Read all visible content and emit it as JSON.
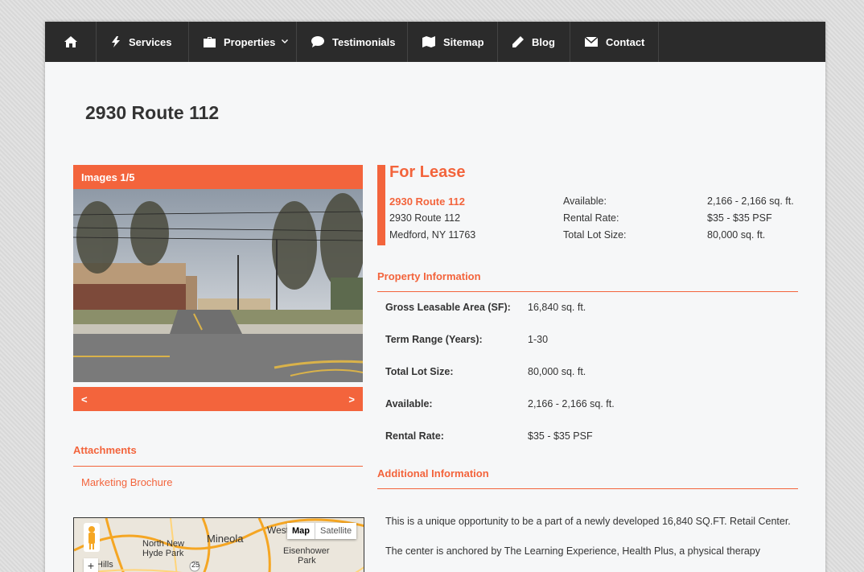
{
  "nav": {
    "items": [
      {
        "label": "Services"
      },
      {
        "label": "Properties"
      },
      {
        "label": "Testimonials"
      },
      {
        "label": "Sitemap"
      },
      {
        "label": "Blog"
      },
      {
        "label": "Contact"
      }
    ]
  },
  "page": {
    "title": "2930 Route 112"
  },
  "gallery": {
    "header": "Images 1/5",
    "prev": "<",
    "next": ">"
  },
  "attachments": {
    "title": "Attachments",
    "links": [
      "Marketing Brochure"
    ]
  },
  "map": {
    "toggle_map": "Map",
    "toggle_satellite": "Satellite",
    "labels": [
      "Mineola",
      "West",
      "North New",
      "Hyde Park",
      "Eisenhower",
      "Park",
      "Hills",
      "25"
    ],
    "zoom_in": "+"
  },
  "lease": {
    "title": "For Lease",
    "address_name": "2930 Route 112",
    "address_line1": "2930 Route 112",
    "address_line2": "Medford, NY 11763",
    "stats": [
      {
        "label": "Available:",
        "value": "2,166 - 2,166 sq. ft."
      },
      {
        "label": "Rental Rate:",
        "value": "$35 - $35 PSF"
      },
      {
        "label": "Total Lot Size:",
        "value": "80,000 sq. ft."
      }
    ]
  },
  "property_info": {
    "title": "Property Information",
    "rows": [
      {
        "label": "Gross Leasable Area (SF):",
        "value": "16,840 sq. ft."
      },
      {
        "label": "Term Range (Years):",
        "value": "1-30"
      },
      {
        "label": "Total Lot Size:",
        "value": "80,000 sq. ft."
      },
      {
        "label": "Available:",
        "value": "2,166 - 2,166 sq. ft."
      },
      {
        "label": "Rental Rate:",
        "value": "$35 - $35 PSF"
      }
    ]
  },
  "additional_info": {
    "title": "Additional Information",
    "paragraphs": [
      "This is a unique opportunity to be a part of a newly developed 16,840 SQ.FT. Retail Center.",
      "The center is anchored by The Learning Experience, Health Plus, a physical therapy"
    ]
  },
  "colors": {
    "accent": "#f3643c",
    "nav_bg": "#2b2b2b",
    "page_bg": "#f6f7f8"
  }
}
